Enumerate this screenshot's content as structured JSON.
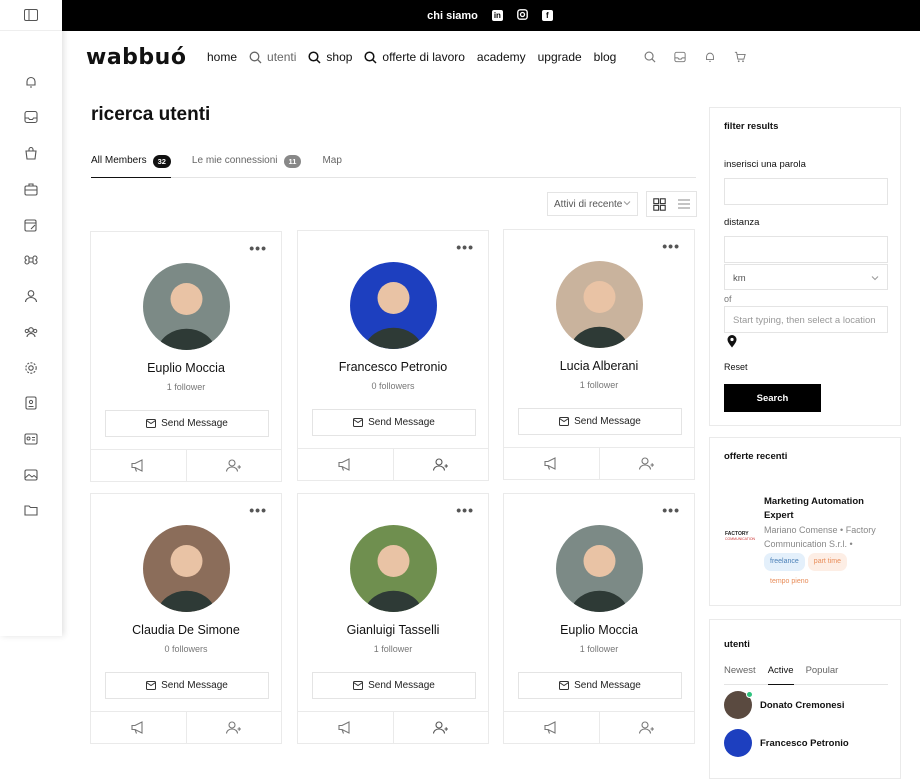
{
  "topbar": {
    "link": "chi siamo",
    "social": [
      "linkedin-icon",
      "instagram-icon",
      "facebook-icon"
    ]
  },
  "logo": "wabbuó",
  "nav": {
    "home": "home",
    "utenti": "utenti",
    "shop": "shop",
    "offerte": "offerte di lavoro",
    "academy": "academy",
    "upgrade": "upgrade",
    "blog": "blog"
  },
  "page": {
    "title": "ricerca utenti"
  },
  "tabs": [
    {
      "label": "All Members",
      "count": "32"
    },
    {
      "label": "Le mie connessioni",
      "count": "11"
    },
    {
      "label": "Map"
    }
  ],
  "sort": {
    "selected": "Attivi di recente"
  },
  "members": [
    {
      "name": "Euplio Moccia",
      "followers": "1 follower",
      "send": "Send Message",
      "avatar_color": "#7c8a86"
    },
    {
      "name": "Francesco Petronio",
      "followers": "0 followers",
      "send": "Send Message",
      "avatar_color": "#1d3fbf"
    },
    {
      "name": "Lucia Alberani",
      "followers": "1 follower",
      "send": "Send Message",
      "avatar_color": "#c9b39d"
    },
    {
      "name": "Claudia De Simone",
      "followers": "0 followers",
      "send": "Send Message",
      "avatar_color": "#8b6d5a"
    },
    {
      "name": "Gianluigi Tasselli",
      "followers": "1 follower",
      "send": "Send Message",
      "avatar_color": "#6f8f4f"
    },
    {
      "name": "Euplio Moccia",
      "followers": "1 follower",
      "send": "Send Message",
      "avatar_color": "#7c8a86"
    }
  ],
  "filter": {
    "title": "filter results",
    "word_label": "inserisci una parola",
    "distance_label": "distanza",
    "unit": "km",
    "of_label": "of",
    "location_placeholder": "Start typing, then select a location",
    "reset": "Reset",
    "search": "Search"
  },
  "offers": {
    "title": "offerte recenti",
    "job_title": "Marketing Automation Expert",
    "company_line1": "Mariano Comense",
    "company_line2": "Factory",
    "company_line3": "Communication S.r.l.",
    "tags": [
      "freelance",
      "part time",
      "tempo pieno"
    ],
    "logo_text": "FACTORY COMMUNICATION"
  },
  "users_panel": {
    "title": "utenti",
    "tabs": [
      "Newest",
      "Active",
      "Popular"
    ],
    "users": [
      "Donato Cremonesi",
      "Francesco Petronio"
    ]
  }
}
